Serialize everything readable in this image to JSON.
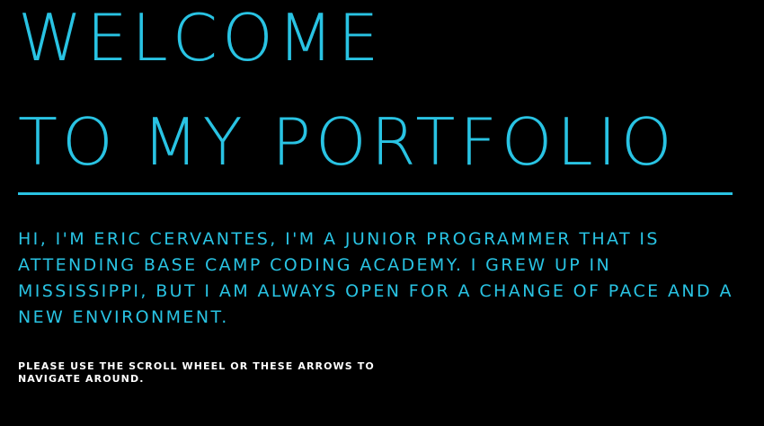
{
  "hero": {
    "title_line_1": "WELCOME",
    "title_line_2": "TO MY PORTFOLIO",
    "accent_color": "#29c3e3"
  },
  "intro": {
    "text": "HI, I'M ERIC CERVANTES, I'M A JUNIOR PROGRAMMER THAT IS ATTENDING BASE CAMP CODING ACADEMY. I GREW UP IN MISSISSIPPI, BUT I AM ALWAYS OPEN FOR A CHANGE OF PACE AND A NEW ENVIRONMENT."
  },
  "navigation_hint": {
    "text": "PLEASE USE THE SCROLL WHEEL OR THESE ARROWS TO NAVIGATE AROUND.",
    "color": "#ffffff"
  },
  "background_color": "#000000"
}
